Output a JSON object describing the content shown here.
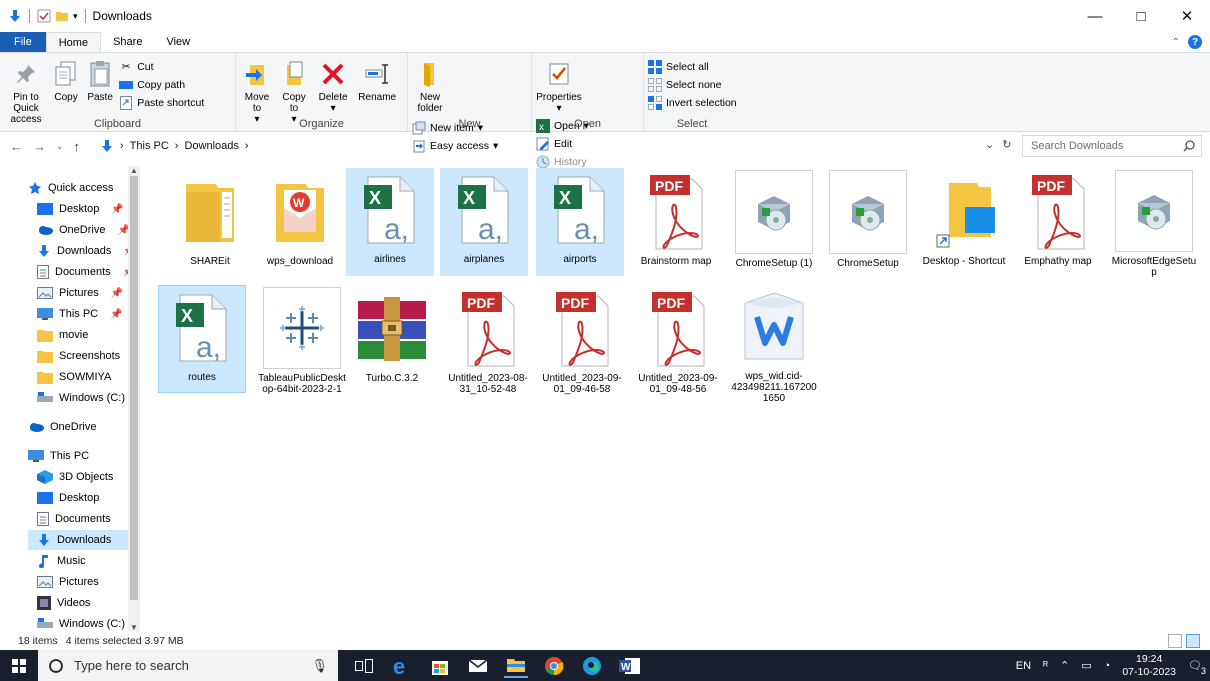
{
  "window": {
    "title": "Downloads",
    "controls": {
      "minimize": "—",
      "maximize": "□",
      "close": "✕"
    }
  },
  "ribbon_tabs": [
    "File",
    "Home",
    "Share",
    "View"
  ],
  "ribbon": {
    "clipboard": {
      "label": "Clipboard",
      "pin": "Pin to Quick access",
      "copy": "Copy",
      "paste": "Paste",
      "cut": "Cut",
      "copy_path": "Copy path",
      "paste_shortcut": "Paste shortcut"
    },
    "organize": {
      "label": "Organize",
      "move_to": "Move to",
      "copy_to": "Copy to",
      "delete": "Delete",
      "rename": "Rename"
    },
    "new": {
      "label": "New",
      "new_folder": "New folder",
      "new_item": "New item",
      "easy_access": "Easy access"
    },
    "open": {
      "label": "Open",
      "properties": "Properties",
      "open": "Open",
      "edit": "Edit",
      "history": "History"
    },
    "select": {
      "label": "Select",
      "select_all": "Select all",
      "select_none": "Select none",
      "invert_selection": "Invert selection"
    }
  },
  "address": {
    "crumbs": [
      "This PC",
      "Downloads"
    ],
    "search_placeholder": "Search Downloads"
  },
  "nav": [
    "Quick access",
    "Desktop",
    "OneDrive",
    "Downloads",
    "Documents",
    "Pictures",
    "This PC",
    "movie",
    "Screenshots",
    "SOWMIYA",
    "Windows (C:)",
    "OneDrive",
    "This PC",
    "3D Objects",
    "Desktop",
    "Documents",
    "Downloads",
    "Music",
    "Pictures",
    "Videos",
    "Windows (C:)"
  ],
  "files": [
    "SHAREit",
    "wps_download",
    "airlines",
    "airplanes",
    "airports",
    "Brainstorm map",
    "ChromeSetup (1)",
    "ChromeSetup",
    "Desktop - Shortcut",
    "Emphathy map",
    "MicrosoftEdgeSetup",
    "routes",
    "TableauPublicDesktop-64bit-2023-2-1",
    "Turbo.C.3.2",
    "Untitled_2023-08-31_10-52-48",
    "Untitled_2023-09-01_09-46-58",
    "Untitled_2023-09-01_09-48-56",
    "wps_wid.cid-423498211.1672001650"
  ],
  "status": {
    "items": "18 items",
    "selected": "4 items selected  3.97 MB"
  },
  "taskbar": {
    "search_placeholder": "Type here to search",
    "lang": "EN",
    "time": "19:24",
    "date": "07-10-2023",
    "notif": "3"
  },
  "colors": {
    "selection": "#cce8ff",
    "accent": "#1a5fb4",
    "taskbar": "#1a1f2e"
  }
}
